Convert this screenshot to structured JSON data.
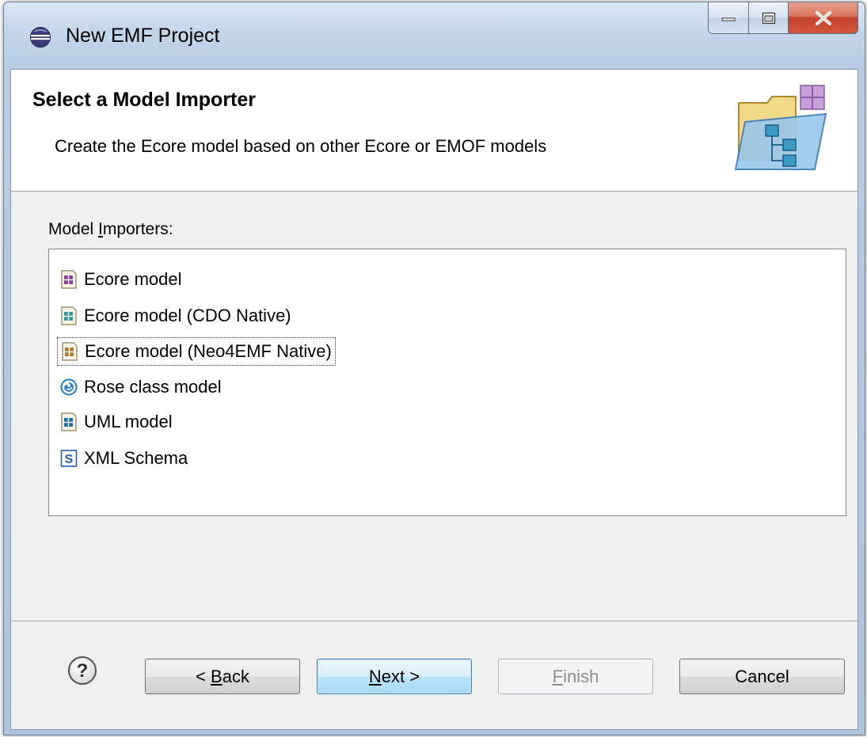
{
  "window": {
    "title": "New EMF Project",
    "icon": "eclipse-icon"
  },
  "banner": {
    "title": "Select a Model Importer",
    "description": "Create the Ecore model based on other Ecore or EMOF models",
    "icon": "model-folder-icon"
  },
  "importers": {
    "label_prefix": "Model ",
    "label_mnemonic": "I",
    "label_suffix": "mporters:",
    "items": [
      {
        "label": "Ecore model",
        "icon": "ecore-icon",
        "color": "#8e3c9c"
      },
      {
        "label": "Ecore model (CDO Native)",
        "icon": "ecore-cdo-icon",
        "color": "#2e9a9a"
      },
      {
        "label": "Ecore model (Neo4EMF Native)",
        "icon": "ecore-neo4emf-icon",
        "color": "#b07a2c",
        "selected": true
      },
      {
        "label": "Rose class model",
        "icon": "rose-icon",
        "color": "#1f7fc6"
      },
      {
        "label": "UML model",
        "icon": "uml-icon",
        "color": "#1d6fa3"
      },
      {
        "label": "XML Schema",
        "icon": "xml-schema-icon",
        "color": "#2a5fae"
      }
    ]
  },
  "footer": {
    "help_icon": "help-icon",
    "back": {
      "pre": "< ",
      "mn": "B",
      "post": "ack"
    },
    "next": {
      "pre": "",
      "mn": "N",
      "post": "ext >"
    },
    "finish": {
      "pre": "",
      "mn": "F",
      "post": "inish"
    },
    "cancel": "Cancel"
  }
}
